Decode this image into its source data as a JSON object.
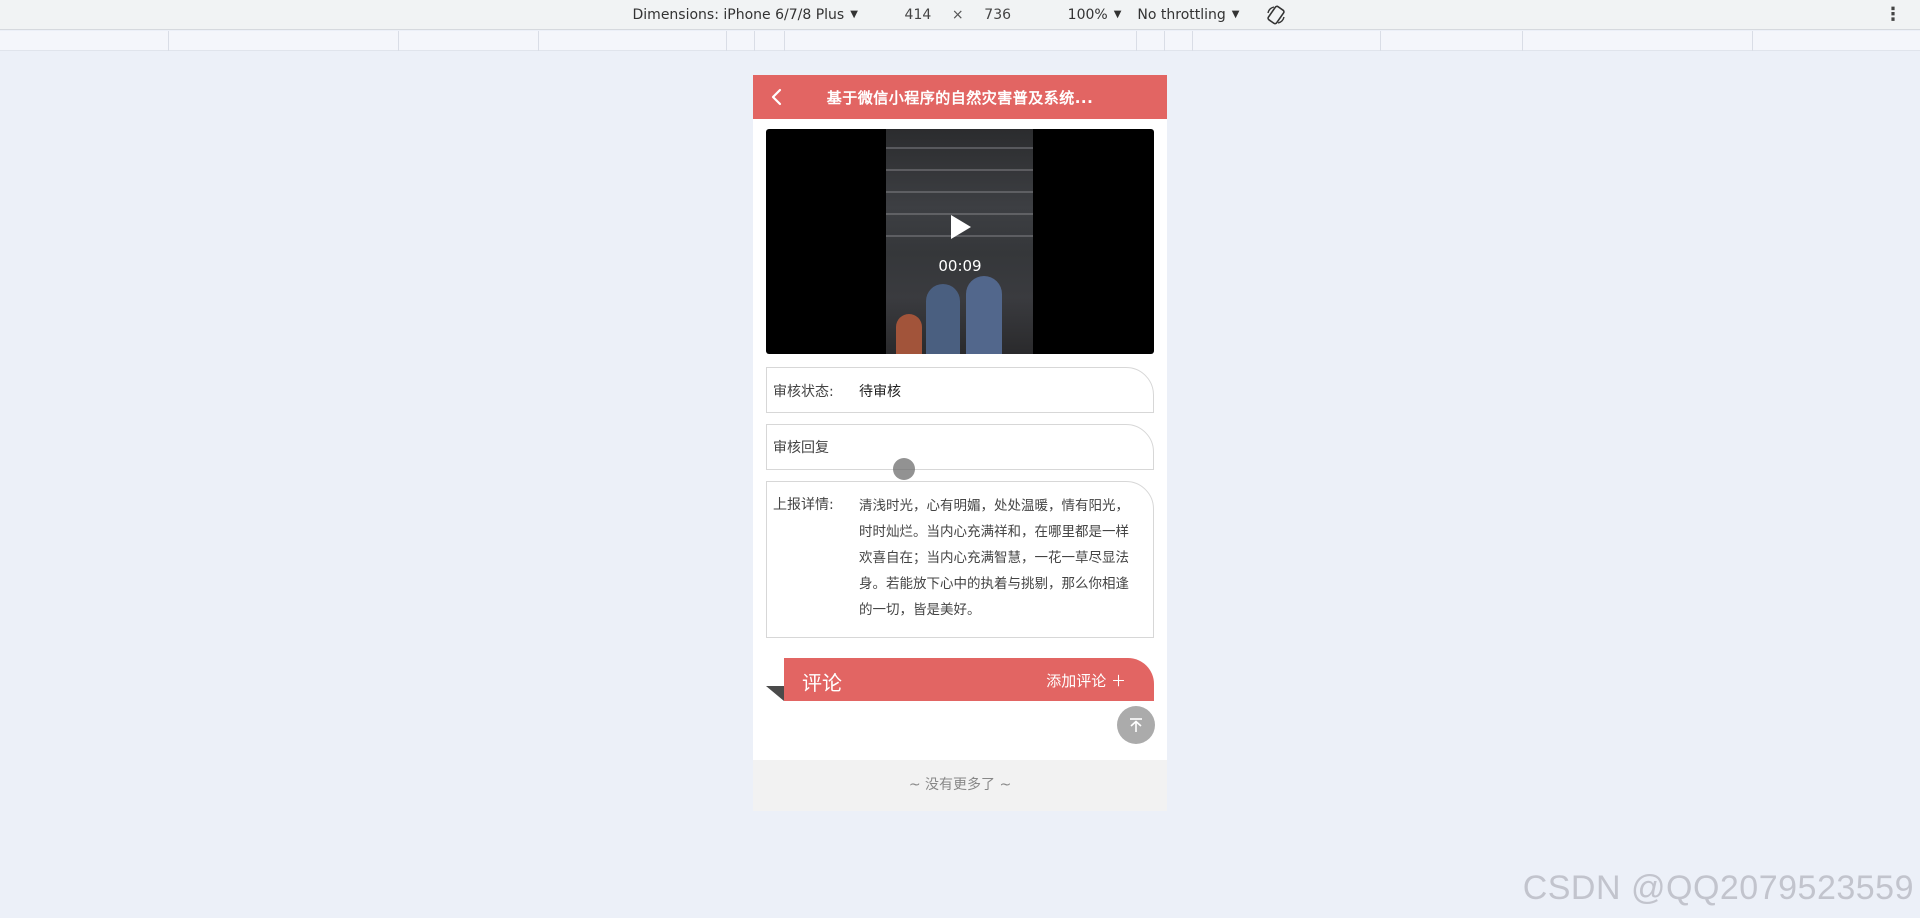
{
  "devtools": {
    "device_label": "Dimensions: iPhone 6/7/8 Plus",
    "width": "414",
    "times": "×",
    "height": "736",
    "zoom": "100%",
    "throttling": "No throttling"
  },
  "page": {
    "nav_title": "基于微信小程序的自然灾害普及系统...",
    "video_duration": "00:09",
    "status_label": "审核状态:",
    "status_value": "待审核",
    "reply_label": "审核回复",
    "detail_label": "上报详情:",
    "detail_text": "清浅时光，心有明媚，处处温暖，情有阳光，时时灿烂。当内心充满祥和，在哪里都是一样欢喜自在；当内心充满智慧，一花一草尽显法身。若能放下心中的执着与挑剔，那么你相逢的一切，皆是美好。",
    "comment_title": "评论",
    "comment_add": "添加评论 ＋",
    "footer_text": "~ 没有更多了 ~"
  },
  "watermark": "CSDN @QQ2079523559",
  "colors": {
    "accent": "#e26563",
    "background": "#ecf0f8"
  },
  "icons": {
    "back": "chevron-left-icon",
    "play": "play-icon",
    "rotate": "rotate-icon",
    "top": "arrow-to-top-icon",
    "more": "kebab-icon"
  }
}
